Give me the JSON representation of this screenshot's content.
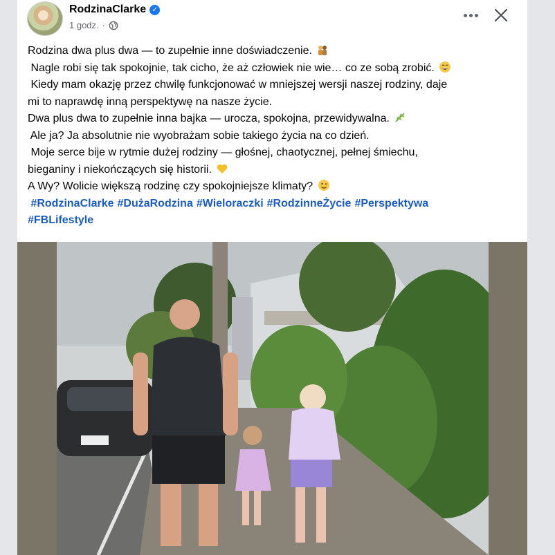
{
  "post": {
    "author": "RodzinaClarke",
    "time": "1 godz.",
    "separator": "·",
    "lines": [
      "Rodzina dwa plus dwa — to zupełnie inne doświadczenie.",
      " Nagle robi się tak spokojnie, tak cicho, że aż człowiek nie wie… co ze sobą zrobić.",
      " Kiedy mam okazję przez chwilę funkcjonować w mniejszej wersji naszej rodziny, daje",
      "mi to naprawdę inną perspektywę na nasze życie.",
      "Dwa plus dwa to zupełnie inna bajka — urocza, spokojna, przewidywalna.",
      " Ale ja? Ja absolutnie nie wyobrażam sobie takiego życia na co dzień.",
      " Moje serce bije w rytmie dużej rodziny — głośnej, chaotycznej, pełnej śmiechu,",
      "bieganiny i niekończących się historii.",
      "A Wy? Wolicie większą rodzinę czy spokojniejsze klimaty?"
    ],
    "hashtags": [
      "#RodzinaClarke",
      "#DużaRodzina",
      "#Wieloraczki",
      "#RodzinneŻycie",
      "#Perspektywa",
      "#FBLifestyle"
    ]
  },
  "icons": {
    "verified": "verified-badge-icon",
    "audience": "globe-icon",
    "more": "more-options-icon",
    "close": "close-icon",
    "emoji_family": "family-emoji",
    "emoji_laugh": "grinning-emoji",
    "emoji_leaf": "herb-emoji",
    "emoji_heart": "yellow-heart-emoji",
    "emoji_wink": "winking-emoji"
  },
  "colors": {
    "verified": "#1877f2",
    "hashtag": "#1a5bc4",
    "meta": "#65676b",
    "photo_matte": "#7b7567"
  }
}
